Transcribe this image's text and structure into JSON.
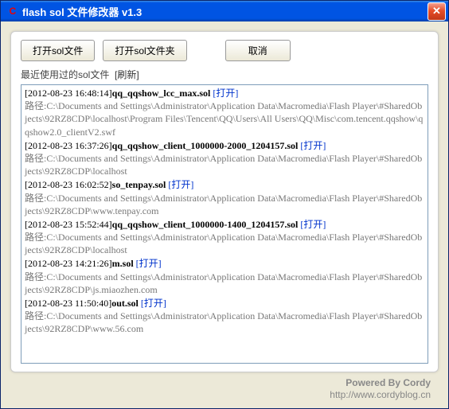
{
  "window": {
    "title": "flash sol 文件修改器 v1.3"
  },
  "buttons": {
    "open_file": "打开sol文件",
    "open_folder": "打开sol文件夹",
    "cancel": "取消"
  },
  "recent": {
    "label": "最近使用过的sol文件",
    "refresh": "[刷新]",
    "open_text": "[打开]",
    "path_prefix": "路径:"
  },
  "entries": [
    {
      "ts": "[2012-08-23 16:48:14]",
      "name": "qq_qqshow_lcc_max.sol",
      "path": "C:\\Documents and Settings\\Administrator\\Application Data\\Macromedia\\Flash Player\\#SharedObjects\\92RZ8CDP\\localhost\\Program Files\\Tencent\\QQ\\Users\\All Users\\QQ\\Misc\\com.tencent.qqshow\\qqshow2.0_clientV2.swf"
    },
    {
      "ts": "[2012-08-23 16:37:26]",
      "name": "qq_qqshow_client_1000000-2000_1204157.sol",
      "path": "C:\\Documents and Settings\\Administrator\\Application Data\\Macromedia\\Flash Player\\#SharedObjects\\92RZ8CDP\\localhost"
    },
    {
      "ts": "[2012-08-23 16:02:52]",
      "name": "so_tenpay.sol",
      "path": "C:\\Documents and Settings\\Administrator\\Application Data\\Macromedia\\Flash Player\\#SharedObjects\\92RZ8CDP\\www.tenpay.com"
    },
    {
      "ts": "[2012-08-23 15:52:44]",
      "name": "qq_qqshow_client_1000000-1400_1204157.sol",
      "path": "C:\\Documents and Settings\\Administrator\\Application Data\\Macromedia\\Flash Player\\#SharedObjects\\92RZ8CDP\\localhost"
    },
    {
      "ts": "[2012-08-23 14:21:26]",
      "name": "m.sol",
      "path": "C:\\Documents and Settings\\Administrator\\Application Data\\Macromedia\\Flash Player\\#SharedObjects\\92RZ8CDP\\js.miaozhen.com"
    },
    {
      "ts": "[2012-08-23 11:50:40]",
      "name": "out.sol",
      "path": "C:\\Documents and Settings\\Administrator\\Application Data\\Macromedia\\Flash Player\\#SharedObjects\\92RZ8CDP\\www.56.com"
    }
  ],
  "footer": {
    "powered": "Powered By Cordy",
    "url": "http://www.cordyblog.cn"
  }
}
